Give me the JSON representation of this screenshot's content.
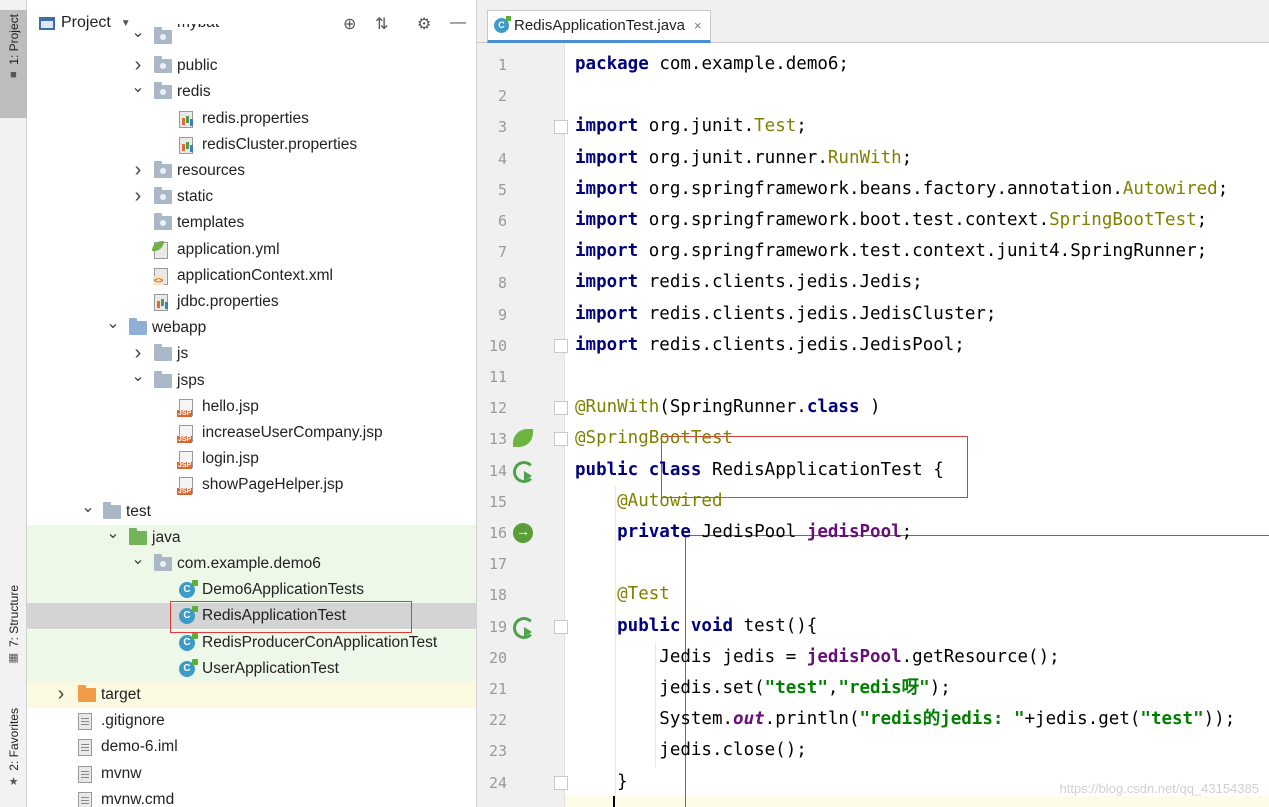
{
  "sidebar": {
    "project_tab": "1: Project",
    "structure_tab": "7: Structure",
    "favorites_tab": "2: Favorites"
  },
  "project_panel": {
    "title": "Project",
    "tree": [
      {
        "label": "mybat",
        "kind": "folder-pkg",
        "indent": 2,
        "arrow": "open",
        "partial": true
      },
      {
        "label": "public",
        "kind": "folder-pkg",
        "indent": 2,
        "arrow": "closed"
      },
      {
        "label": "redis",
        "kind": "folder-pkg",
        "indent": 2,
        "arrow": "open"
      },
      {
        "label": "redis.properties",
        "kind": "props",
        "indent": 3
      },
      {
        "label": "redisCluster.properties",
        "kind": "props",
        "indent": 3
      },
      {
        "label": "resources",
        "kind": "folder-pkg",
        "indent": 2,
        "arrow": "closed"
      },
      {
        "label": "static",
        "kind": "folder-pkg",
        "indent": 2,
        "arrow": "closed"
      },
      {
        "label": "templates",
        "kind": "folder-pkg",
        "indent": 2
      },
      {
        "label": "application.yml",
        "kind": "yml",
        "indent": 2
      },
      {
        "label": "applicationContext.xml",
        "kind": "xml",
        "indent": 2
      },
      {
        "label": "jdbc.properties",
        "kind": "props",
        "indent": 2
      },
      {
        "label": "webapp",
        "kind": "folder-web",
        "indent": 1,
        "arrow": "open"
      },
      {
        "label": "js",
        "kind": "folder",
        "indent": 2,
        "arrow": "closed"
      },
      {
        "label": "jsps",
        "kind": "folder",
        "indent": 2,
        "arrow": "open"
      },
      {
        "label": "hello.jsp",
        "kind": "jsp",
        "indent": 3
      },
      {
        "label": "increaseUserCompany.jsp",
        "kind": "jsp",
        "indent": 3
      },
      {
        "label": "login.jsp",
        "kind": "jsp",
        "indent": 3
      },
      {
        "label": "showPageHelper.jsp",
        "kind": "jsp",
        "indent": 3
      },
      {
        "label": "test",
        "kind": "folder",
        "indent": 0,
        "arrow": "open"
      },
      {
        "label": "java",
        "kind": "folder-green",
        "indent": 1,
        "arrow": "open",
        "bg": "green"
      },
      {
        "label": "com.example.demo6",
        "kind": "folder-pkg",
        "indent": 2,
        "arrow": "open",
        "bg": "green"
      },
      {
        "label": "Demo6ApplicationTests",
        "kind": "class",
        "indent": 3,
        "bg": "green"
      },
      {
        "label": "RedisApplicationTest",
        "kind": "class",
        "indent": 3,
        "bg": "sel"
      },
      {
        "label": "RedisProducerConApplicationTest",
        "kind": "class",
        "indent": 3,
        "bg": "green"
      },
      {
        "label": "UserApplicationTest",
        "kind": "class",
        "indent": 3,
        "bg": "green"
      },
      {
        "label": "target",
        "kind": "folder-orange",
        "indent": -1,
        "arrow": "closed",
        "bg": "yellow"
      },
      {
        "label": ".gitignore",
        "kind": "plain",
        "indent": -1
      },
      {
        "label": "demo-6.iml",
        "kind": "plain",
        "indent": -1
      },
      {
        "label": "mvnw",
        "kind": "plain",
        "indent": -1
      },
      {
        "label": "mvnw.cmd",
        "kind": "plain",
        "indent": -1
      }
    ]
  },
  "editor": {
    "tab_label": "RedisApplicationTest.java",
    "tab_close": "×",
    "watermark": "https://blog.csdn.net/qq_43154385",
    "lines": [
      [
        [
          "kw",
          "package"
        ],
        [
          "",
          "com.example.demo6;"
        ]
      ],
      [],
      [
        [
          "kw",
          "import"
        ],
        [
          "",
          "org.junit."
        ],
        [
          "ty",
          "Test"
        ],
        [
          "",
          ";"
        ]
      ],
      [
        [
          "kw",
          "import"
        ],
        [
          "",
          "org.junit.runner."
        ],
        [
          "ty",
          "RunWith"
        ],
        [
          "",
          ";"
        ]
      ],
      [
        [
          "kw",
          "import"
        ],
        [
          "",
          "org.springframework.beans.factory.annotation."
        ],
        [
          "ty",
          "Autowired"
        ],
        [
          "",
          ";"
        ]
      ],
      [
        [
          "kw",
          "import"
        ],
        [
          "",
          "org.springframework.boot.test.context."
        ],
        [
          "ty",
          "SpringBootTest"
        ],
        [
          "",
          ";"
        ]
      ],
      [
        [
          "kw",
          "import"
        ],
        [
          "",
          "org.springframework.test.context.junit4.SpringRunner;"
        ]
      ],
      [
        [
          "kw",
          "import"
        ],
        [
          "",
          "redis.clients.jedis.Jedis;"
        ]
      ],
      [
        [
          "kw",
          "import"
        ],
        [
          "",
          "redis.clients.jedis.JedisCluster;"
        ]
      ],
      [
        [
          "kw",
          "import"
        ],
        [
          "",
          "redis.clients.jedis.JedisPool;"
        ]
      ],
      [],
      [
        [
          "an",
          "@RunWith"
        ],
        [
          "",
          "(SpringRunner."
        ],
        [
          "kw",
          "class"
        ],
        [
          "",
          ")"
        ]
      ],
      [
        [
          "an",
          "@SpringBootTest"
        ]
      ],
      [
        [
          "kw",
          "public class"
        ],
        [
          "",
          "RedisApplicationTest {"
        ]
      ],
      [
        [
          "an",
          "    @Autowired"
        ]
      ],
      [
        [
          "kw",
          "    private"
        ],
        [
          "",
          "JedisPool "
        ],
        [
          "fd",
          "jedisPool"
        ],
        [
          "",
          ";"
        ]
      ],
      [],
      [
        [
          "an",
          "    @Test"
        ]
      ],
      [
        [
          "kw",
          "    public void"
        ],
        [
          "",
          "test(){"
        ]
      ],
      [
        [
          "",
          "        Jedis jedis = "
        ],
        [
          "fd",
          "jedisPool"
        ],
        [
          "",
          ".getResource();"
        ]
      ],
      [
        [
          "",
          "        jedis.set("
        ],
        [
          "st",
          "\"test\""
        ],
        [
          "",
          ","
        ],
        [
          "st",
          "\"redis呀\""
        ],
        [
          "",
          ");"
        ]
      ],
      [
        [
          "",
          "        System."
        ],
        [
          "it",
          "out"
        ],
        [
          "",
          ".println("
        ],
        [
          "st",
          "\"redis的jedis: \""
        ],
        [
          "",
          "+jedis.get("
        ],
        [
          "st",
          "\"test\""
        ],
        [
          "",
          "));"
        ]
      ],
      [
        [
          "",
          "        jedis.close();"
        ]
      ],
      [
        [
          "",
          "    }"
        ]
      ]
    ]
  }
}
